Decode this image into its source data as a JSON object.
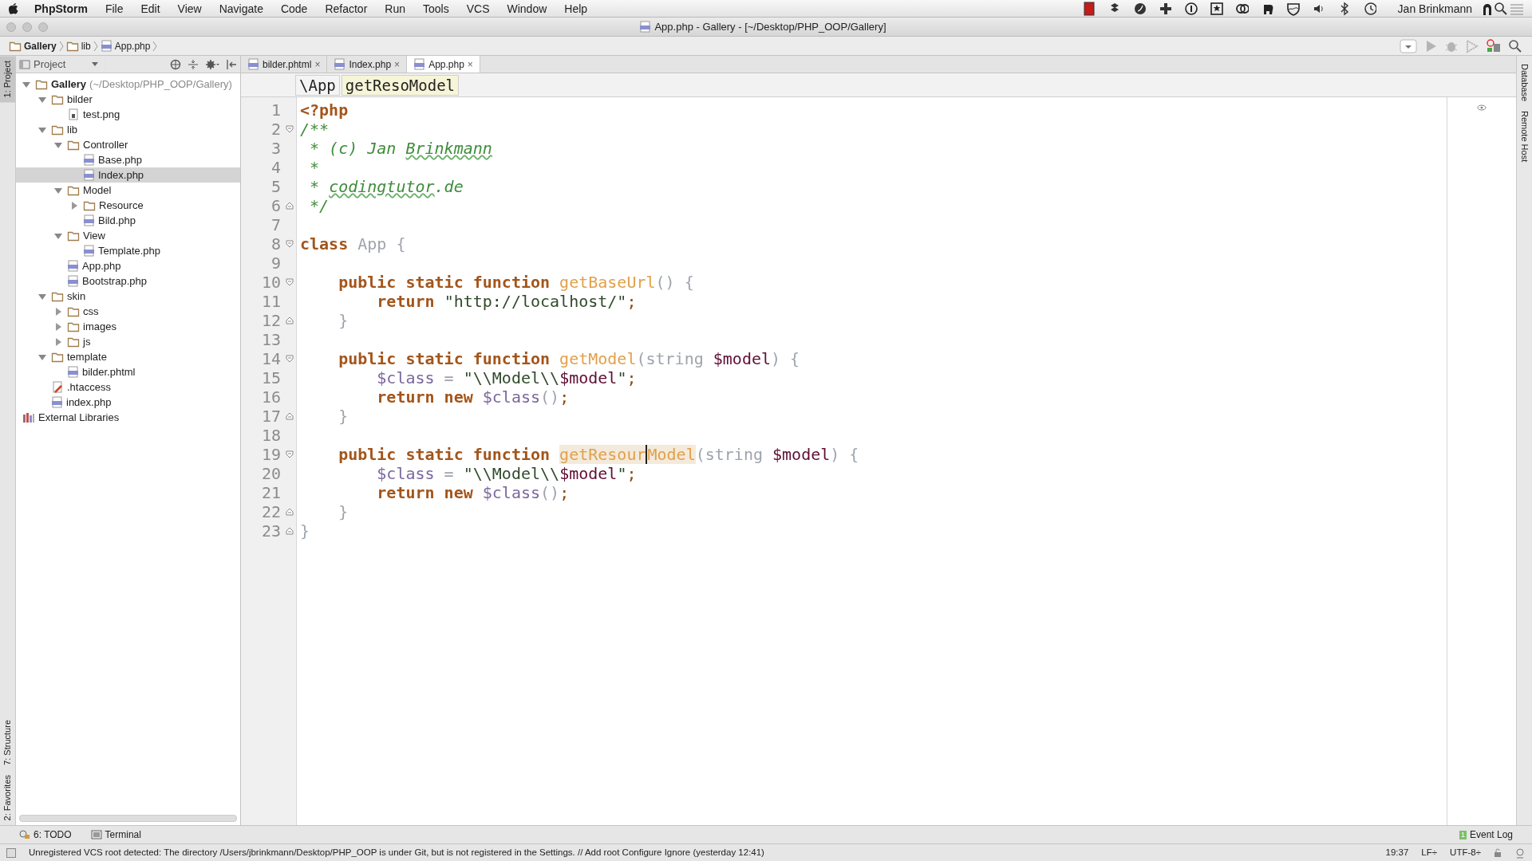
{
  "menu_bar": {
    "app": "PhpStorm",
    "items": [
      "File",
      "Edit",
      "View",
      "Navigate",
      "Code",
      "Refactor",
      "Run",
      "Tools",
      "VCS",
      "Window",
      "Help"
    ],
    "user": "Jan Brinkmann"
  },
  "window": {
    "title": "App.php - Gallery - [~/Desktop/PHP_OOP/Gallery]"
  },
  "nav_bar": {
    "crumbs": [
      "Gallery",
      "lib",
      "App.php"
    ]
  },
  "tool_stripes": {
    "left_top": [
      {
        "label": "1: Project",
        "selected": true
      }
    ],
    "left_bottom": [
      {
        "label": "7: Structure",
        "selected": false
      },
      {
        "label": "2: Favorites",
        "selected": false
      }
    ],
    "right": [
      {
        "label": "Database"
      },
      {
        "label": "Remote Host"
      }
    ]
  },
  "project_panel": {
    "title": "Project",
    "tree": [
      {
        "name": "Gallery",
        "suffix": "(~/Desktop/PHP_OOP/Gallery)",
        "kind": "folder",
        "expanded": true,
        "selected": false,
        "children": [
          {
            "name": "bilder",
            "kind": "folder",
            "expanded": true,
            "selected": false,
            "children": [
              {
                "name": "test.png",
                "kind": "image",
                "selected": false
              }
            ]
          },
          {
            "name": "lib",
            "kind": "folder",
            "expanded": true,
            "selected": false,
            "children": [
              {
                "name": "Controller",
                "kind": "folder",
                "expanded": true,
                "selected": false,
                "children": [
                  {
                    "name": "Base.php",
                    "kind": "php",
                    "selected": false
                  },
                  {
                    "name": "Index.php",
                    "kind": "php",
                    "selected": true
                  }
                ]
              },
              {
                "name": "Model",
                "kind": "folder",
                "expanded": true,
                "selected": false,
                "children": [
                  {
                    "name": "Resource",
                    "kind": "folder",
                    "expanded": false,
                    "selected": false
                  },
                  {
                    "name": "Bild.php",
                    "kind": "php",
                    "selected": false
                  }
                ]
              },
              {
                "name": "View",
                "kind": "folder",
                "expanded": true,
                "selected": false,
                "children": [
                  {
                    "name": "Template.php",
                    "kind": "php",
                    "selected": false
                  }
                ]
              },
              {
                "name": "App.php",
                "kind": "php",
                "selected": false
              },
              {
                "name": "Bootstrap.php",
                "kind": "php",
                "selected": false
              }
            ]
          },
          {
            "name": "skin",
            "kind": "folder",
            "expanded": true,
            "selected": false,
            "children": [
              {
                "name": "css",
                "kind": "folder",
                "expanded": false,
                "selected": false
              },
              {
                "name": "images",
                "kind": "folder",
                "expanded": false,
                "selected": false
              },
              {
                "name": "js",
                "kind": "folder",
                "expanded": false,
                "selected": false
              }
            ]
          },
          {
            "name": "template",
            "kind": "folder",
            "expanded": true,
            "selected": false,
            "children": [
              {
                "name": "bilder.phtml",
                "kind": "php",
                "selected": false
              }
            ]
          },
          {
            "name": ".htaccess",
            "kind": "htaccess",
            "selected": false
          },
          {
            "name": "index.php",
            "kind": "php",
            "selected": false
          }
        ]
      },
      {
        "name": "External Libraries",
        "kind": "library",
        "selected": false
      }
    ]
  },
  "tabs": [
    {
      "label": "bilder.phtml",
      "close": "×",
      "selected": false
    },
    {
      "label": "Index.php",
      "close": "×",
      "selected": false
    },
    {
      "label": "App.php",
      "close": "×",
      "selected": true
    }
  ],
  "editor": {
    "crumbs": [
      "\\App",
      "getResoModel"
    ],
    "lines": [
      {
        "number": "1",
        "fold_start": false,
        "fold_end": false,
        "tokens": [
          {
            "kind": "tag",
            "text": "<?php"
          }
        ]
      },
      {
        "number": "2",
        "fold_start": true,
        "fold_end": false,
        "tokens": [
          {
            "kind": "comment",
            "text": "/**"
          }
        ]
      },
      {
        "number": "3",
        "fold_start": false,
        "fold_end": false,
        "tokens": [
          {
            "kind": "comment",
            "text": " * (c) Jan "
          },
          {
            "kind": "typo",
            "text": "Brinkmann"
          }
        ]
      },
      {
        "number": "4",
        "fold_start": false,
        "fold_end": false,
        "tokens": [
          {
            "kind": "comment",
            "text": " *"
          }
        ]
      },
      {
        "number": "5",
        "fold_start": false,
        "fold_end": false,
        "tokens": [
          {
            "kind": "comment",
            "text": " * "
          },
          {
            "kind": "typo",
            "text": "codingtutor"
          },
          {
            "kind": "comment",
            "text": ".de"
          }
        ]
      },
      {
        "number": "6",
        "fold_start": false,
        "fold_end": true,
        "tokens": [
          {
            "kind": "comment",
            "text": " */"
          }
        ]
      },
      {
        "number": "7",
        "fold_start": false,
        "fold_end": false
      },
      {
        "number": "8",
        "fold_start": true,
        "fold_end": false,
        "tokens": [
          {
            "kind": "keyword",
            "text": "class"
          },
          {
            "kind": "punct",
            "text": " App {"
          }
        ]
      },
      {
        "number": "9",
        "fold_start": false,
        "fold_end": false
      },
      {
        "number": "10",
        "fold_start": true,
        "fold_end": false,
        "tokens": [
          {
            "kind": "keyword",
            "text": "    public static function "
          },
          {
            "kind": "function",
            "text": "getBaseUrl"
          },
          {
            "kind": "punct",
            "text": "() {"
          }
        ]
      },
      {
        "number": "11",
        "fold_start": false,
        "fold_end": false,
        "tokens": [
          {
            "kind": "keyword",
            "text": "        return "
          },
          {
            "kind": "string",
            "text": "\"http://localhost/\""
          },
          {
            "kind": "semi",
            "text": ";"
          }
        ]
      },
      {
        "number": "12",
        "fold_start": false,
        "fold_end": true,
        "tokens": [
          {
            "kind": "punct",
            "text": "    }"
          }
        ]
      },
      {
        "number": "13",
        "fold_start": false,
        "fold_end": false
      },
      {
        "number": "14",
        "fold_start": true,
        "fold_end": false,
        "tokens": [
          {
            "kind": "keyword",
            "text": "    public static function "
          },
          {
            "kind": "function",
            "text": "getModel"
          },
          {
            "kind": "punct",
            "text": "(string "
          },
          {
            "kind": "param",
            "text": "$model"
          },
          {
            "kind": "punct",
            "text": ") {"
          }
        ]
      },
      {
        "number": "15",
        "fold_start": false,
        "fold_end": false,
        "tokens": [
          {
            "kind": "variable",
            "text": "        $class"
          },
          {
            "kind": "punct",
            "text": " = "
          },
          {
            "kind": "string",
            "text": "\"\\\\Model\\\\"
          },
          {
            "kind": "param",
            "text": "$model"
          },
          {
            "kind": "string",
            "text": "\""
          },
          {
            "kind": "semi",
            "text": ";"
          }
        ]
      },
      {
        "number": "16",
        "fold_start": false,
        "fold_end": false,
        "tokens": [
          {
            "kind": "keyword",
            "text": "        return new "
          },
          {
            "kind": "variable",
            "text": "$class"
          },
          {
            "kind": "punct",
            "text": "()"
          },
          {
            "kind": "semi",
            "text": ";"
          }
        ]
      },
      {
        "number": "17",
        "fold_start": false,
        "fold_end": true,
        "tokens": [
          {
            "kind": "punct",
            "text": "    }"
          }
        ]
      },
      {
        "number": "18",
        "fold_start": false,
        "fold_end": false
      },
      {
        "number": "19",
        "fold_start": true,
        "fold_end": false,
        "tokens": [
          {
            "kind": "keyword",
            "text": "    public static function "
          },
          {
            "kind": "function_highlight",
            "text": "getResour"
          },
          {
            "kind": "function_highlight",
            "text": "Model",
            "caret": true
          },
          {
            "kind": "punct",
            "text": "(string "
          },
          {
            "kind": "param",
            "text": "$model"
          },
          {
            "kind": "punct",
            "text": ") {"
          }
        ]
      },
      {
        "number": "20",
        "fold_start": false,
        "fold_end": false,
        "tokens": [
          {
            "kind": "variable",
            "text": "        $class"
          },
          {
            "kind": "punct",
            "text": " = "
          },
          {
            "kind": "string",
            "text": "\"\\\\Model\\\\"
          },
          {
            "kind": "param",
            "text": "$model"
          },
          {
            "kind": "string",
            "text": "\""
          },
          {
            "kind": "semi",
            "text": ";"
          }
        ]
      },
      {
        "number": "21",
        "fold_start": false,
        "fold_end": false,
        "tokens": [
          {
            "kind": "keyword",
            "text": "        return new "
          },
          {
            "kind": "variable",
            "text": "$class"
          },
          {
            "kind": "punct",
            "text": "()"
          },
          {
            "kind": "semi",
            "text": ";"
          }
        ]
      },
      {
        "number": "22",
        "fold_start": false,
        "fold_end": true,
        "tokens": [
          {
            "kind": "punct",
            "text": "    }"
          }
        ]
      },
      {
        "number": "23",
        "fold_start": false,
        "fold_end": true,
        "tokens": [
          {
            "kind": "punct",
            "text": "}"
          }
        ]
      }
    ]
  },
  "bottom_bar": {
    "tools": [
      "6: TODO",
      "Terminal"
    ],
    "event_log": {
      "label": "Event Log",
      "count": "1"
    }
  },
  "status_bar": {
    "message": "Unregistered VCS root detected: The directory /Users/jbrinkmann/Desktop/PHP_OOP is under Git, but is not registered in the Settings. // Add root  Configure  Ignore (yesterday 12:41)",
    "position": "19:37",
    "line_separator": "LF÷",
    "encoding": "UTF-8÷"
  }
}
